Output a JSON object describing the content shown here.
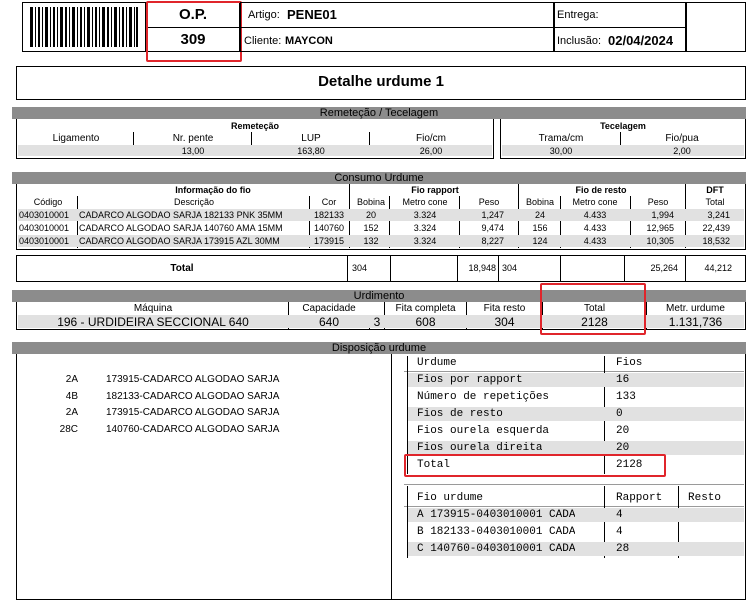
{
  "header": {
    "op_label": "O.P.",
    "op_number": "309",
    "artigo_label": "Artigo:",
    "artigo_value": "PENE01",
    "cliente_label": "Cliente:",
    "cliente_value": "MAYCON",
    "entrega_label": "Entrega:",
    "entrega_value": "",
    "inclusao_label": "Inclusão:",
    "inclusao_value": "02/04/2024"
  },
  "title": "Detalhe urdume 1",
  "remeteção": {
    "bar": "Remeteção / Tecelagem",
    "group_remetecao": "Remeteção",
    "group_tecelagem": "Tecelagem",
    "cols": [
      "Ligamento",
      "Nr. pente",
      "LUP",
      "Fio/cm",
      "Trama/cm",
      "Fio/pua"
    ],
    "values": [
      "",
      "13,00",
      "163,80",
      "26,00",
      "30,00",
      "2,00"
    ]
  },
  "consumo": {
    "bar": "Consumo Urdume",
    "group_info": "Informação do fio",
    "group_rapport": "Fio rapport",
    "group_resto": "Fio de resto",
    "group_dft": "DFT",
    "cols": [
      "Código",
      "Descrição",
      "Cor",
      "Bobina",
      "Metro cone",
      "Peso",
      "Bobina",
      "Metro cone",
      "Peso",
      "Total"
    ],
    "rows": [
      [
        "0403010001",
        "CADARCO ALGODAO SARJA 182133 PNK 35MM",
        "182133",
        "20",
        "3.324",
        "1,247",
        "24",
        "4.433",
        "1,994",
        "3,241"
      ],
      [
        "0403010001",
        "CADARCO ALGODAO SARJA 140760 AMA 15MM",
        "140760",
        "152",
        "3.324",
        "9,474",
        "156",
        "4.433",
        "12,965",
        "22,439"
      ],
      [
        "0403010001",
        "CADARCO ALGODAO SARJA 173915 AZL 30MM",
        "173915",
        "132",
        "3.324",
        "8,227",
        "124",
        "4.433",
        "10,305",
        "18,532"
      ]
    ],
    "total_label": "Total",
    "totals": [
      "304",
      "",
      "18,948",
      "304",
      "",
      "25,264",
      "44,212"
    ]
  },
  "urdimento": {
    "bar": "Urdimento",
    "cols": [
      "Máquina",
      "Capacidade",
      "Fita completa",
      "Fita resto",
      "Total",
      "Metr. urdume"
    ],
    "maquina": "196 - URDIDEIRA SECCIONAL 640",
    "capacidade": "640",
    "extra": "3",
    "fita_completa": "608",
    "fita_resto": "304",
    "total": "2128",
    "metr_urdume": "1.131,736"
  },
  "disposicao": {
    "bar": "Disposição urdume",
    "items": [
      {
        "code": "2A",
        "desc": "173915-CADARCO ALGODAO SARJA"
      },
      {
        "code": "4B",
        "desc": "182133-CADARCO ALGODAO SARJA"
      },
      {
        "code": "2A",
        "desc": "173915-CADARCO ALGODAO SARJA"
      },
      {
        "code": "28C",
        "desc": "140760-CADARCO ALGODAO SARJA"
      }
    ],
    "summary_head": [
      "Urdume",
      "Fios"
    ],
    "summary_rows": [
      [
        "Fios por rapport",
        "16"
      ],
      [
        "Número de repetições",
        "133"
      ],
      [
        "Fios de resto",
        "0"
      ],
      [
        "Fios ourela esquerda",
        "20"
      ],
      [
        "Fios ourela direita",
        "20"
      ],
      [
        "Total",
        "2128"
      ]
    ],
    "fio_head": [
      "Fio urdume",
      "Rapport",
      "Resto"
    ],
    "fio_rows": [
      [
        "A 173915-0403010001 CADA",
        "4",
        ""
      ],
      [
        "B 182133-0403010001 CADA",
        "4",
        ""
      ],
      [
        "C 140760-0403010001 CADA",
        "28",
        ""
      ]
    ]
  },
  "colors": {
    "highlight": "#e0252b",
    "section_bar": "#8c8c8c",
    "row_gray": "#e1e1e1"
  }
}
